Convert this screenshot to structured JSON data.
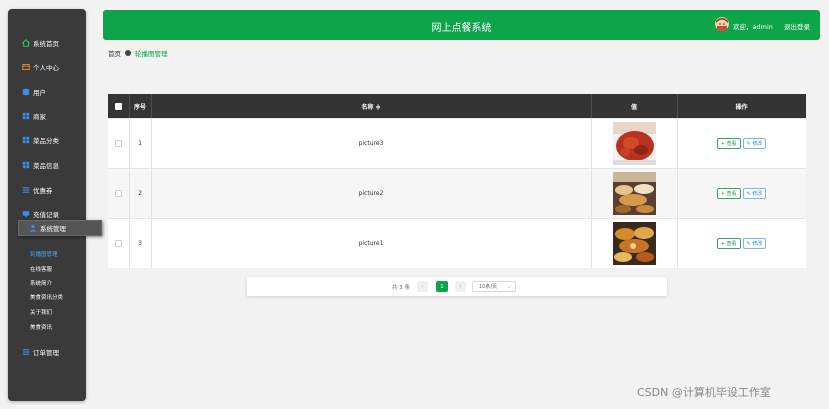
{
  "header": {
    "title": "网上点餐系统",
    "welcome": "欢迎，admin",
    "logout": "退出登录"
  },
  "sidebar": {
    "items": [
      {
        "label": "系统首页",
        "icon": "home-icon"
      },
      {
        "label": "个人中心",
        "icon": "wallet-icon"
      },
      {
        "label": "用户",
        "icon": "cylinder-icon"
      },
      {
        "label": "商家",
        "icon": "grid-icon"
      },
      {
        "label": "菜品分类",
        "icon": "grid-icon"
      },
      {
        "label": "菜品信息",
        "icon": "grid-icon"
      },
      {
        "label": "优惠券",
        "icon": "list-icon"
      },
      {
        "label": "充值记录",
        "icon": "monitor-icon"
      },
      {
        "label": "系统管理",
        "icon": "user-icon"
      },
      {
        "label": "订单管理",
        "icon": "list-icon"
      }
    ],
    "sub_items": [
      "轮播图管理",
      "在线客服",
      "系统简介",
      "美食资讯分类",
      "关于我们",
      "美食资讯"
    ]
  },
  "breadcrumb": {
    "home": "首页",
    "current": "轮播图管理"
  },
  "table": {
    "headers": {
      "index": "序号",
      "name": "名称 ≑",
      "value": "值",
      "actions": "操作"
    },
    "rows": [
      {
        "index": "1",
        "name": "picture3"
      },
      {
        "index": "2",
        "name": "picture2"
      },
      {
        "index": "3",
        "name": "picture1"
      }
    ],
    "view_label": "查看",
    "edit_label": "修改"
  },
  "pagination": {
    "total": "共 3 条",
    "prev": "‹",
    "page": "1",
    "next": "›",
    "page_size": "10条/页"
  },
  "watermark": "CSDN @计算机毕设工作室"
}
